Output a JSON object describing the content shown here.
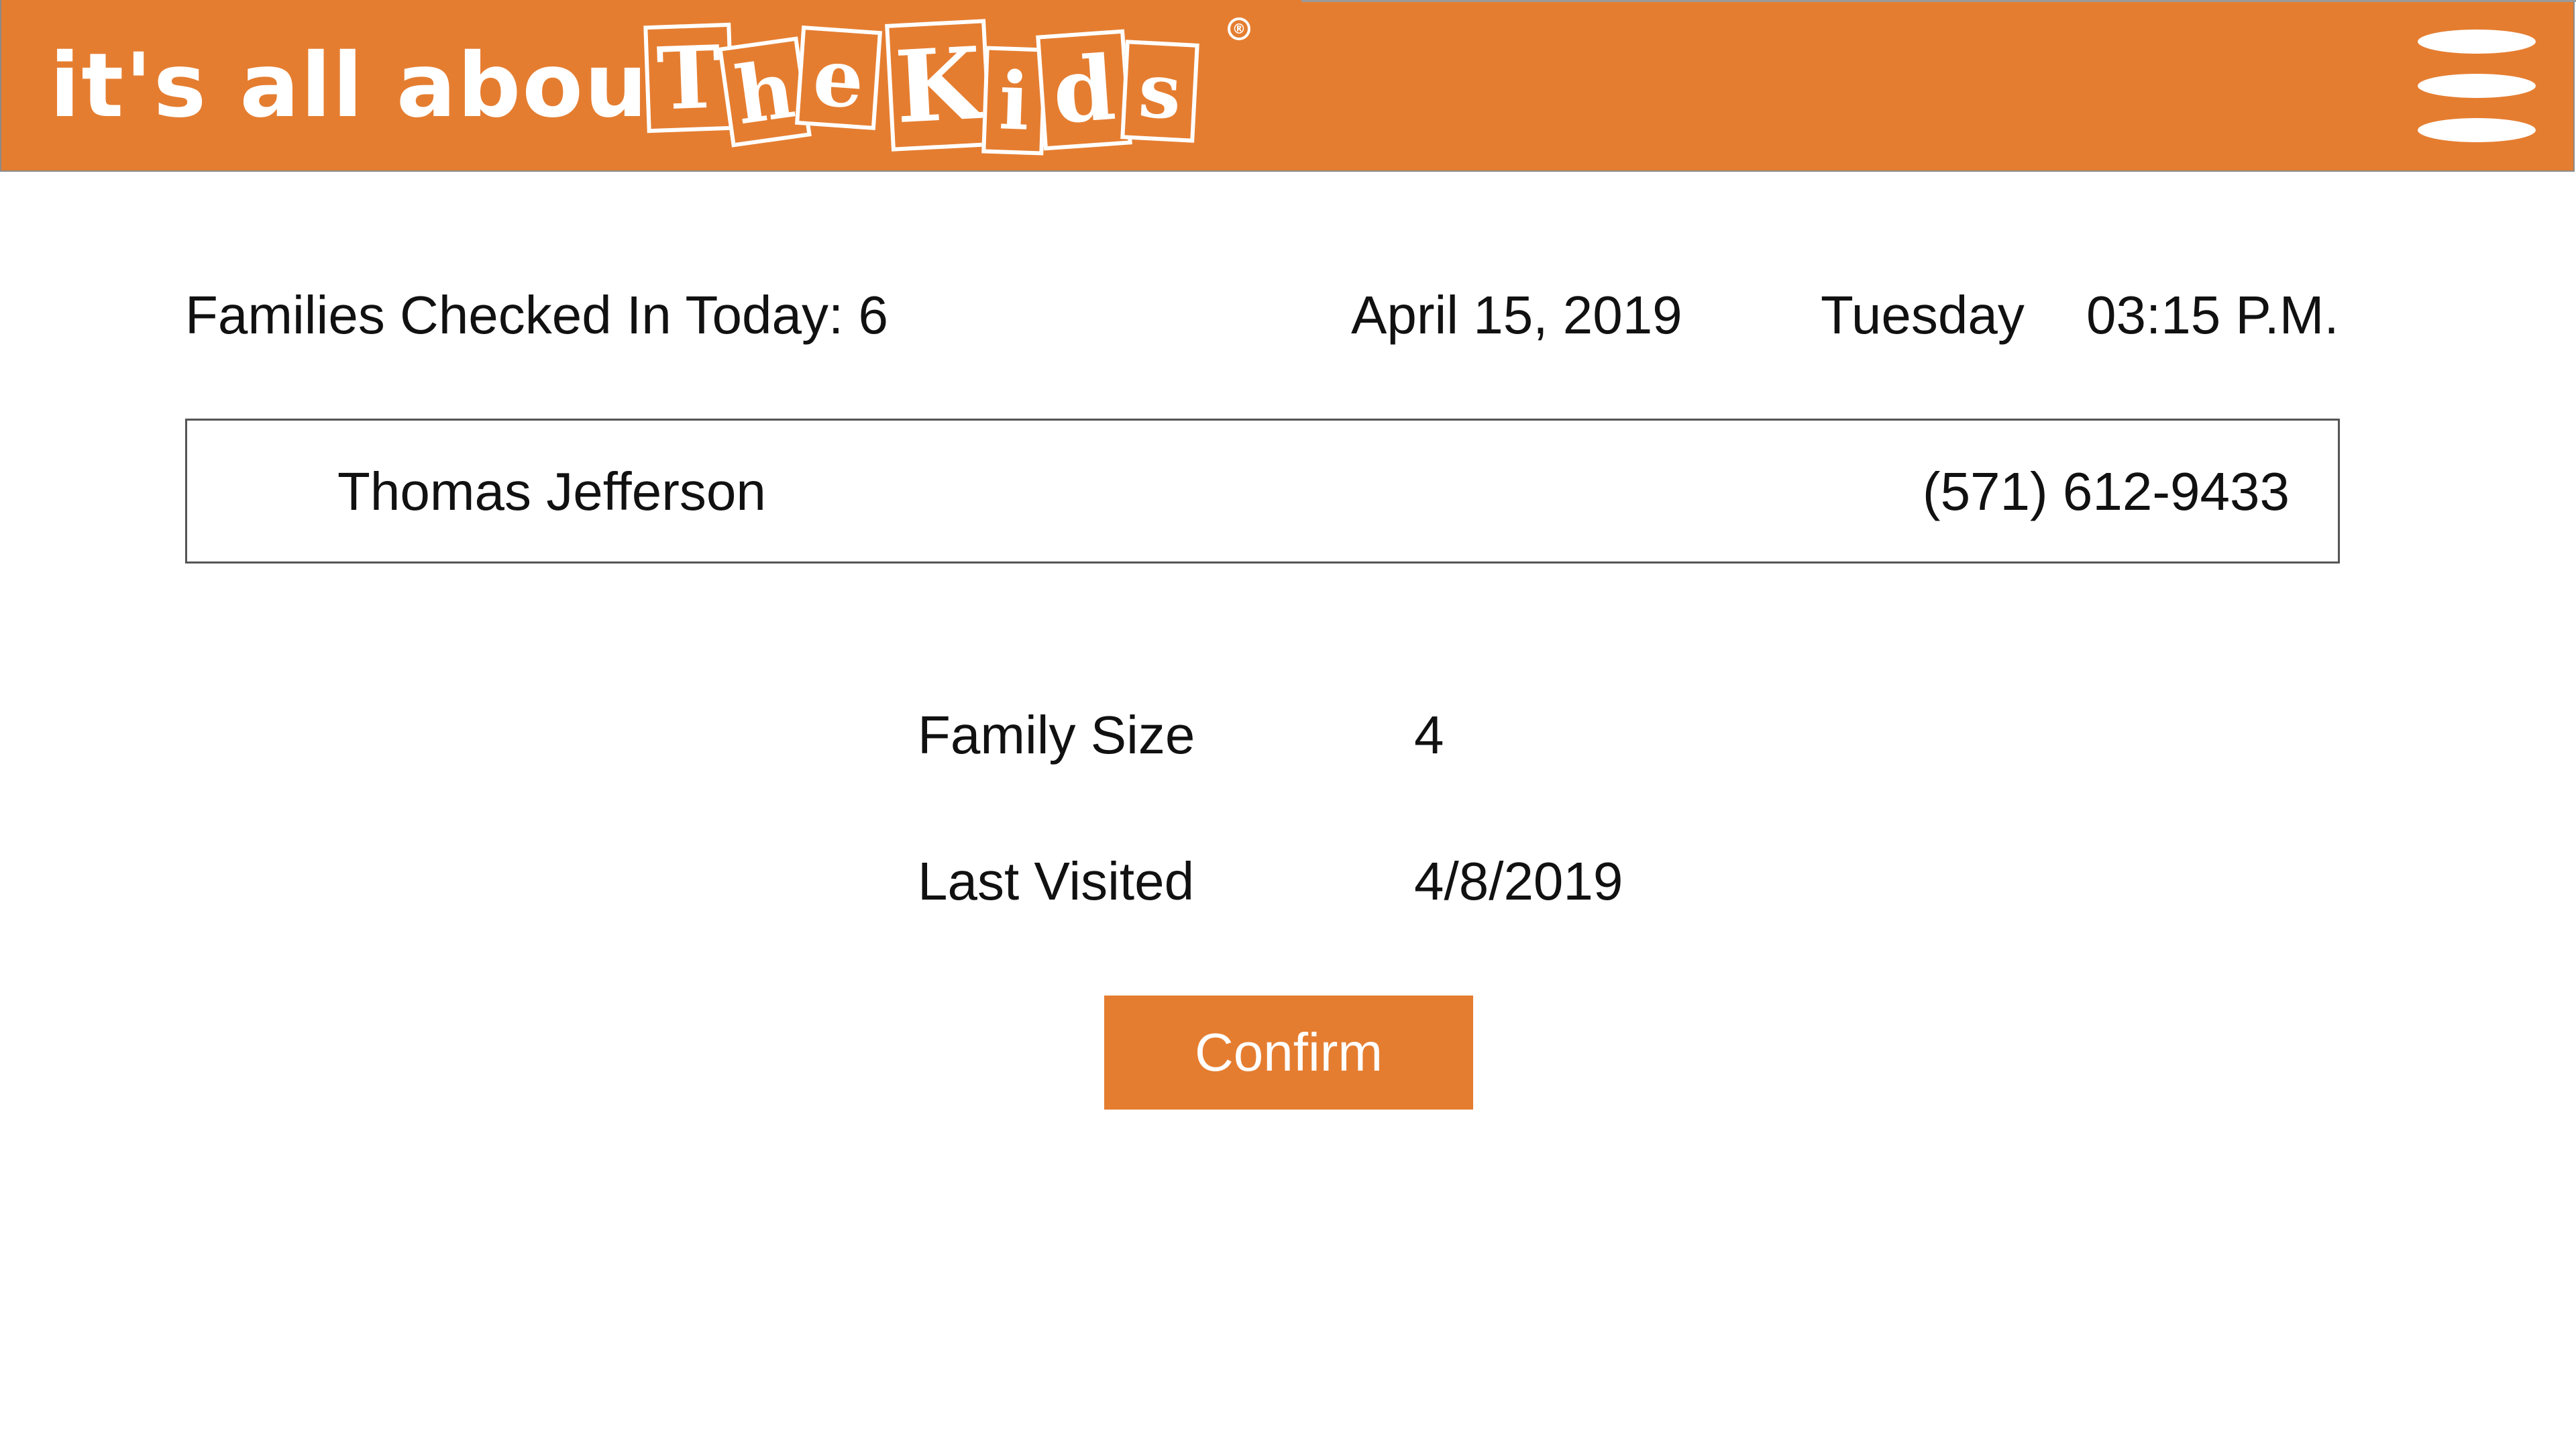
{
  "header": {
    "logo_prefix": "it's all about",
    "logo_tiles": [
      "T",
      "h",
      "e",
      "K",
      "i",
      "d",
      "s"
    ],
    "logo_registered_mark": "®",
    "brand_color": "#e57d30",
    "menu_icon": "hamburger-menu-icon"
  },
  "status": {
    "families_checked_in_label": "Families Checked In Today: 6",
    "date": "April 15, 2019",
    "weekday": "Tuesday",
    "time": "03:15 P.M."
  },
  "family": {
    "name": "Thomas Jefferson",
    "phone": "(571) 612-9433"
  },
  "details": {
    "family_size_label": "Family Size",
    "family_size_value": "4",
    "last_visited_label": "Last Visited",
    "last_visited_value": "4/8/2019"
  },
  "actions": {
    "confirm_label": "Confirm"
  }
}
